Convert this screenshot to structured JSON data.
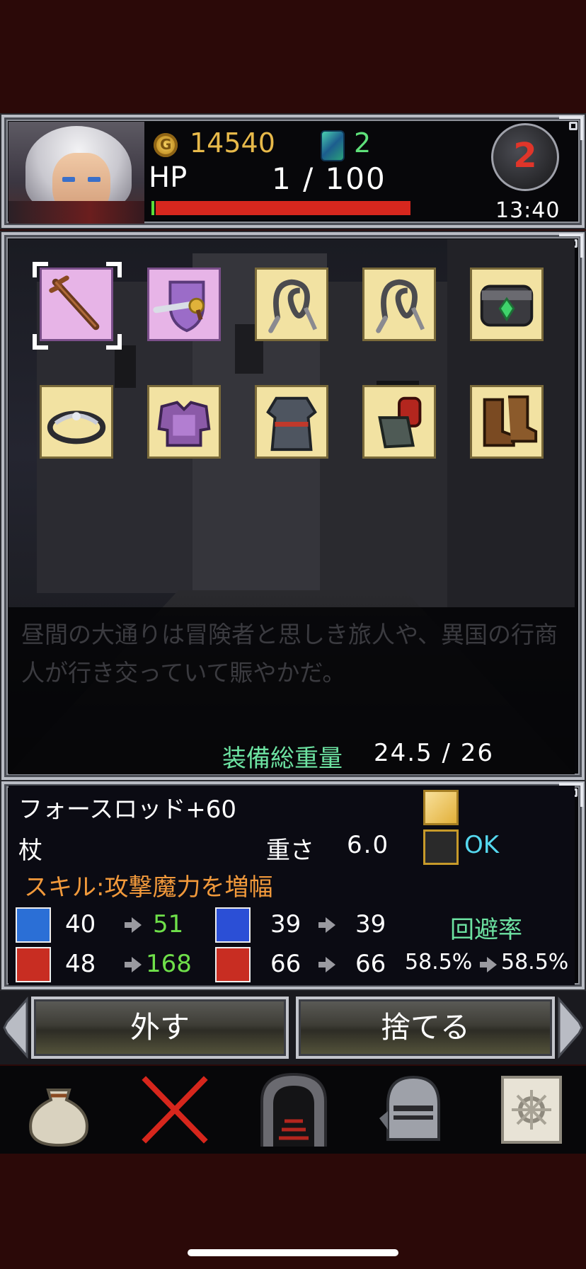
{
  "status": {
    "gold": "14540",
    "gems": "2",
    "hp_label": "HP",
    "hp_value": "1 / 100",
    "hp_fraction": 0.01,
    "floor": "2",
    "time": "13:40"
  },
  "equipment": {
    "slots": [
      {
        "name": "staff-icon",
        "selected": true,
        "highlight": "pink"
      },
      {
        "name": "shield-sword-icon",
        "selected": false,
        "highlight": "pink"
      },
      {
        "name": "whip-icon",
        "selected": false,
        "highlight": "yellow"
      },
      {
        "name": "whip-icon",
        "selected": false,
        "highlight": "yellow"
      },
      {
        "name": "bracelet-icon",
        "selected": false,
        "highlight": "yellow"
      },
      {
        "name": "tiara-icon",
        "selected": false,
        "highlight": "yellow"
      },
      {
        "name": "armor-icon",
        "selected": false,
        "highlight": "yellow"
      },
      {
        "name": "robe-icon",
        "selected": false,
        "highlight": "yellow"
      },
      {
        "name": "gauntlet-icon",
        "selected": false,
        "highlight": "yellow"
      },
      {
        "name": "boots-icon",
        "selected": false,
        "highlight": "yellow"
      }
    ],
    "description": "昼間の大通りは冒険者と思しき旅人や、異国の行商人が行き交っていて賑やかだ。",
    "weight_label": "装備総重量",
    "weight_value": "24.5 / 26"
  },
  "item": {
    "name": "フォースロッド+60",
    "type": "杖",
    "weight_label": "重さ",
    "weight_value": "6.0",
    "ok": "OK",
    "skill": "スキル:攻撃魔力を増幅",
    "attack": {
      "before": "40",
      "after": "51"
    },
    "defense": {
      "before": "39",
      "after": "39"
    },
    "evasion_label": "回避率",
    "magic_attack": {
      "before": "48",
      "after": "168"
    },
    "magic_defense": {
      "before": "66",
      "after": "66"
    },
    "evasion": {
      "before": "58.5%",
      "after": "58.5%"
    }
  },
  "actions": {
    "unequip": "外す",
    "discard": "捨てる"
  },
  "colors": {
    "gold": "#e7b94a",
    "gem": "#5ee07a",
    "hp_bar": "#d7271e",
    "weight_label": "#6de3a2",
    "skill": "#f1993b",
    "ok": "#55d8ef"
  }
}
